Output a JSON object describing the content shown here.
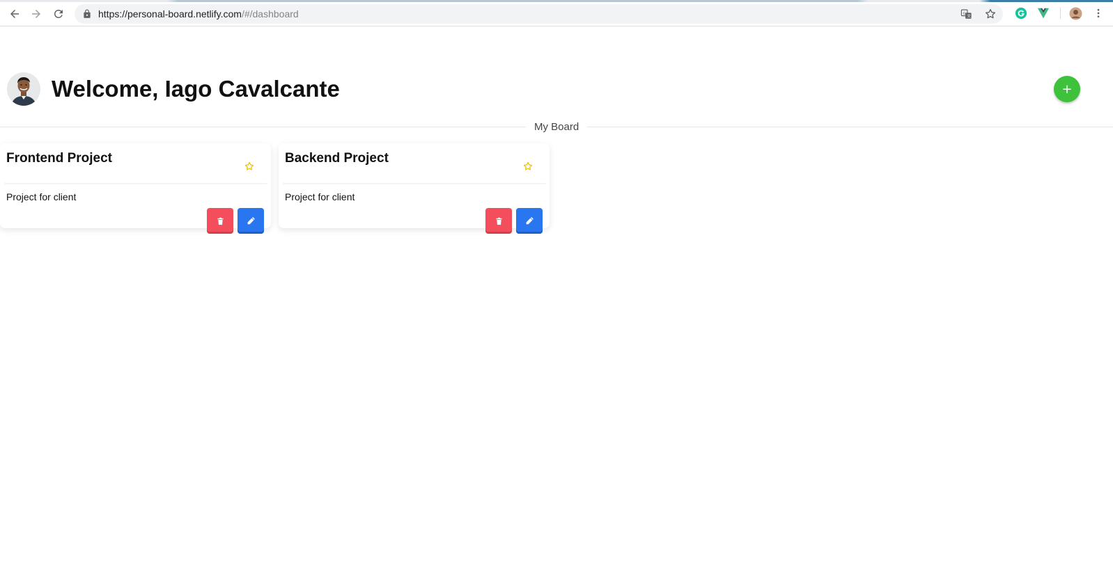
{
  "browser": {
    "url_host": "https://personal-board.netlify.com",
    "url_path": "/#/dashboard",
    "back_icon": "arrow-left-icon",
    "forward_icon": "arrow-right-icon",
    "reload_icon": "reload-icon",
    "lock_icon": "lock-icon",
    "translate_icon": "translate-icon",
    "bookmark_icon": "star-outline-icon",
    "extensions": [
      "grammarly-icon",
      "vue-devtools-icon"
    ],
    "profile_icon": "profile-avatar-icon",
    "menu_icon": "kebab-menu-icon",
    "grammarly_color": "#15c39a",
    "vue_color": "#41b883"
  },
  "header": {
    "avatar_icon": "user-avatar",
    "welcome": "Welcome, Iago Cavalcante",
    "add_label": "+",
    "add_color": "#3ec13b"
  },
  "board": {
    "divider_label": "My Board"
  },
  "cards": [
    {
      "title": "Frontend Project",
      "description": "Project for client",
      "favorite_icon": "star-outline-icon",
      "delete_icon": "trash-icon",
      "edit_icon": "pencil-icon"
    },
    {
      "title": "Backend Project",
      "description": "Project for client",
      "favorite_icon": "star-outline-icon",
      "delete_icon": "trash-icon",
      "edit_icon": "pencil-icon"
    }
  ],
  "colors": {
    "delete": "#f44d5c",
    "edit": "#2a75f0",
    "star": "#f2c200"
  }
}
